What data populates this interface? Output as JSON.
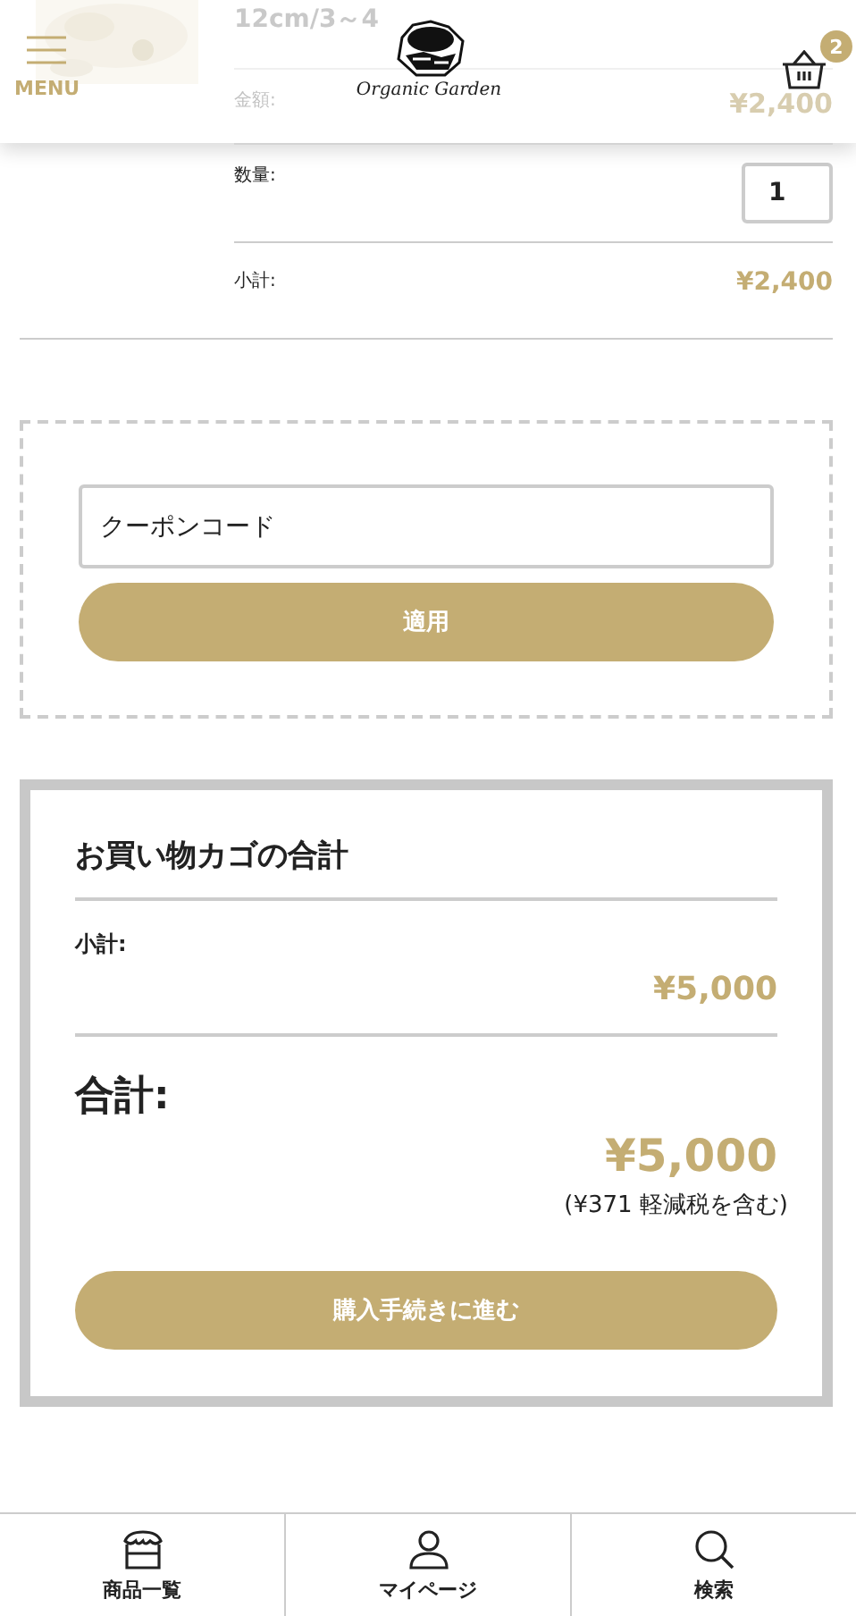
{
  "header": {
    "menu_label": "MENU",
    "logo_text": "Organic Garden",
    "cart_count": "2"
  },
  "cart_item": {
    "title": "12cm/3～4",
    "price_label": "金額:",
    "price": "¥2,400",
    "qty_label": "数量:",
    "qty": "1",
    "subtotal_label": "小計:",
    "subtotal": "¥2,400"
  },
  "coupon": {
    "placeholder": "クーポンコード",
    "button": "適用"
  },
  "totals": {
    "title": "お買い物カゴの合計",
    "subtotal_label": "小計:",
    "subtotal": "¥5,000",
    "total_label": "合計:",
    "total": "¥5,000",
    "tax_note": "(¥371 軽減税を含む)",
    "checkout": "購入手続きに進む"
  },
  "bottom_nav": [
    {
      "kind": "shop",
      "label": "商品一覧"
    },
    {
      "kind": "user",
      "label": "マイページ"
    },
    {
      "kind": "search",
      "label": "検索"
    }
  ]
}
